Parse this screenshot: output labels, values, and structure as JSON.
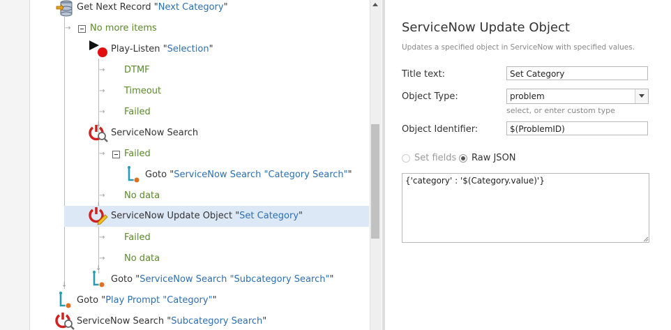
{
  "tree": {
    "get_next_record": {
      "name": "Get Next Record",
      "open_q": "\"",
      "value": "Next Category",
      "close_q": "\""
    },
    "no_more_items": "No more items",
    "play_listen": {
      "name": "Play-Listen",
      "open_q": "\"",
      "value": "Selection",
      "close_q": "\""
    },
    "dtmf": "DTMF",
    "timeout": "Timeout",
    "failed_1": "Failed",
    "sn_search": {
      "name": "ServiceNow Search"
    },
    "failed_2": "Failed",
    "goto_1": {
      "name": "Goto",
      "open_q": "\"",
      "value": "ServiceNow Search \"Category Search\"",
      "close_q": "\""
    },
    "no_data_1": "No data",
    "sn_update": {
      "name": "ServiceNow Update Object",
      "open_q": "\"",
      "value": "Set Category",
      "close_q": "\""
    },
    "failed_3": "Failed",
    "no_data_2": "No data",
    "goto_2": {
      "name": "Goto",
      "open_q": "\"",
      "value": "ServiceNow Search \"Subcategory Search\"",
      "close_q": "\""
    },
    "goto_3": {
      "name": "Goto",
      "open_q": "\"",
      "value": "Play Prompt \"Category\"",
      "close_q": "\""
    },
    "sn_search_2": {
      "name": "ServiceNow Search",
      "open_q": "\"",
      "value": "Subcategory Search",
      "close_q": "\""
    }
  },
  "panel": {
    "title": "ServiceNow Update Object",
    "description": "Updates a specified object in ServiceNow with specified values.",
    "title_text_label": "Title text:",
    "title_text_value": "Set Category",
    "object_type_label": "Object Type:",
    "object_type_value": "problem",
    "object_type_hint": "select, or enter custom type",
    "object_identifier_label": "Object Identifier:",
    "object_identifier_value": "$(ProblemID)",
    "radio_set_fields": "Set fields",
    "radio_raw_json": "Raw JSON",
    "selected_mode": "Raw JSON",
    "json_value": "{'category' : '$(Category.value)'}"
  },
  "colors": {
    "branch_green": "#5a8a2a",
    "value_blue": "#2d6fb0",
    "selected_row": "#dde8f6",
    "icon_red": "#cc2222"
  }
}
